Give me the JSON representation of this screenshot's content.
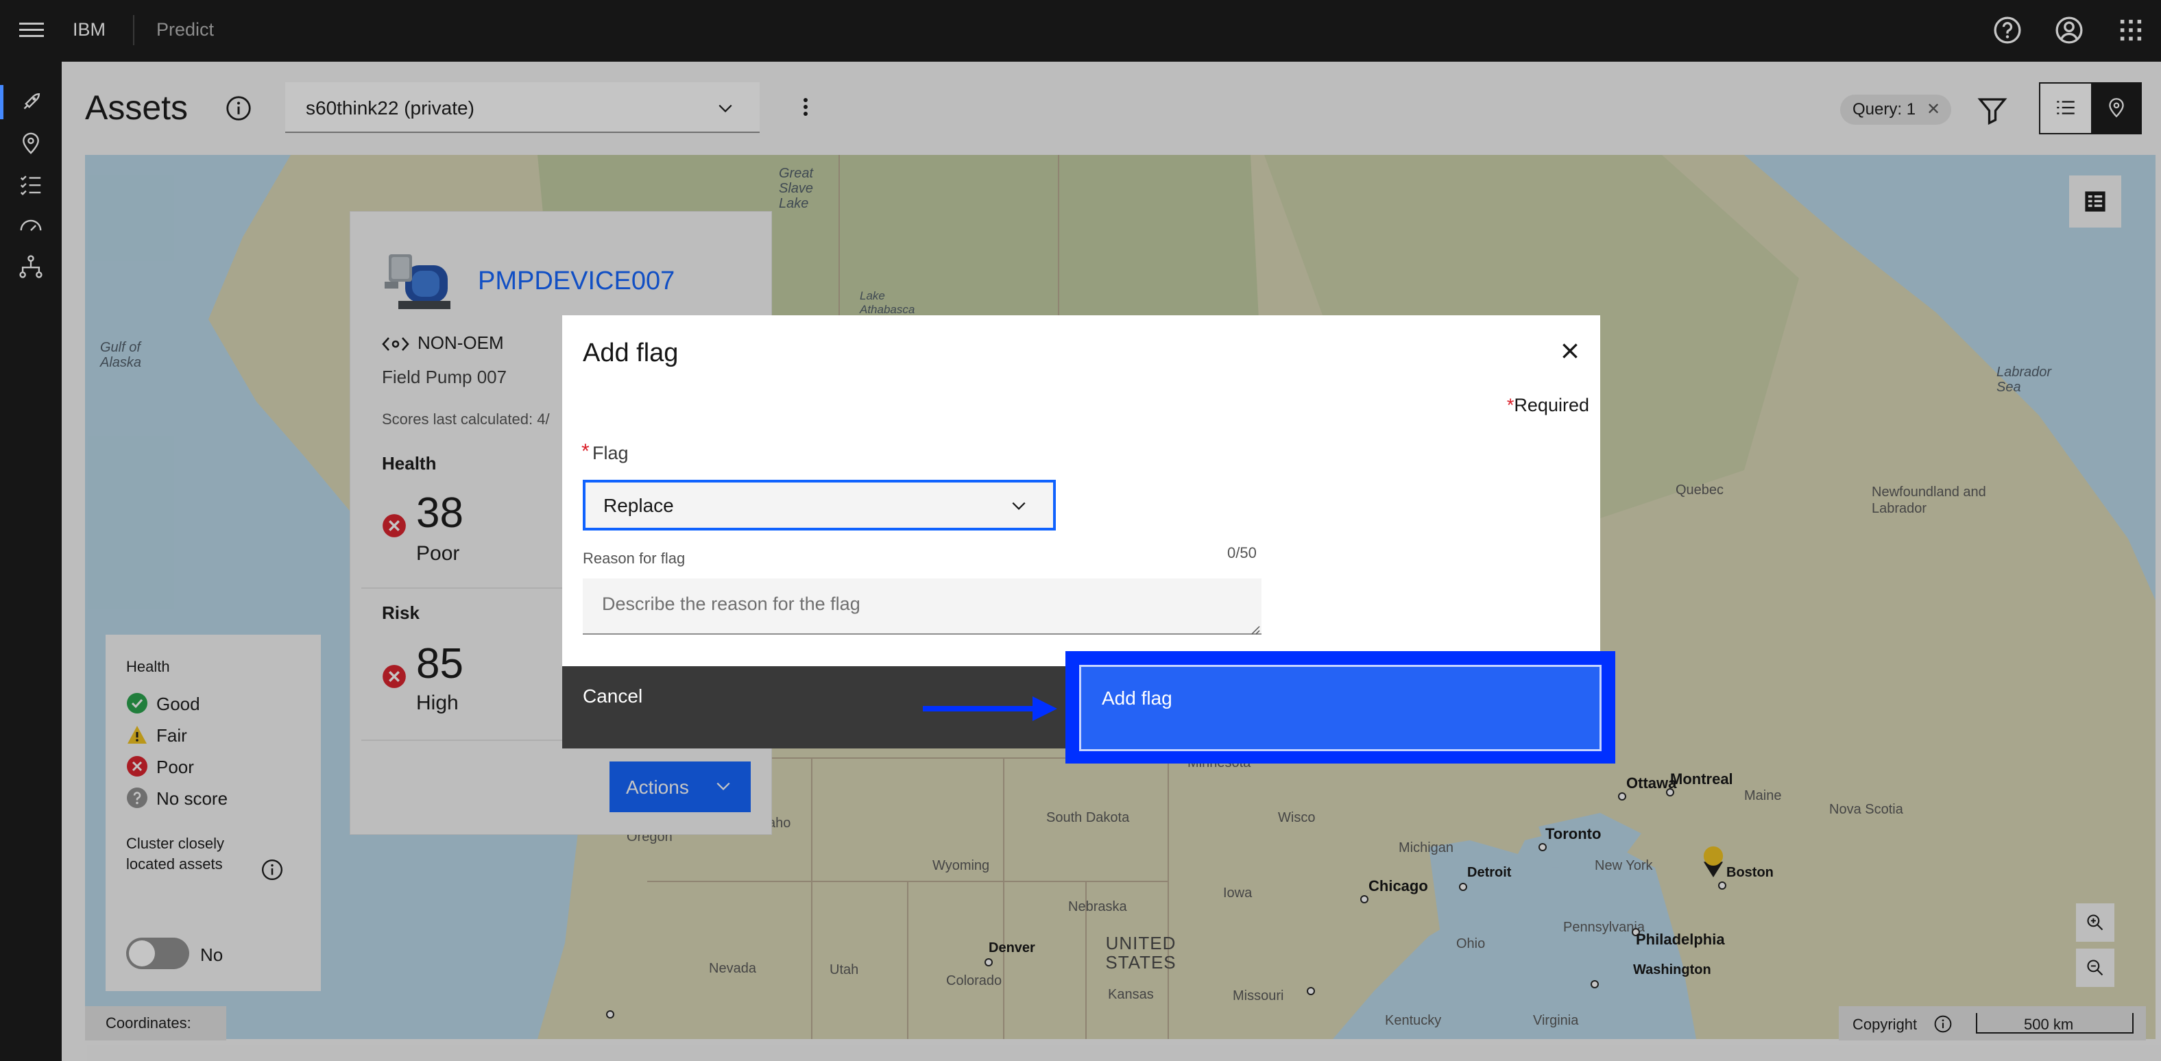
{
  "header": {
    "brand": "IBM",
    "product": "Predict"
  },
  "page": {
    "title": "Assets",
    "dataset_selected": "s60think22 (private)",
    "query_tag": "Query: 1"
  },
  "asset_card": {
    "name": "PMPDEVICE007",
    "oem": "NON-OEM",
    "description": "Field Pump 007",
    "scores_last_calculated": "Scores last calculated: 4/",
    "health": {
      "title": "Health",
      "value": "38",
      "label": "Poor"
    },
    "risk": {
      "title": "Risk",
      "value": "85",
      "label": "High"
    },
    "actions_label": "Actions"
  },
  "legend": {
    "title": "Health",
    "items": [
      {
        "label": "Good",
        "icon": "check-circle-icon",
        "color": "#24a148"
      },
      {
        "label": "Fair",
        "icon": "warning-triangle-icon",
        "color": "#f1c21b"
      },
      {
        "label": "Poor",
        "icon": "error-circle-icon",
        "color": "#da1e28"
      },
      {
        "label": "No score",
        "icon": "help-circle-icon",
        "color": "#8d8d8d"
      }
    ],
    "cluster_label": "Cluster closely located assets",
    "toggle_label": "No"
  },
  "map": {
    "labels": {
      "gulf_of_alaska": "Gulf of Alaska",
      "great_slave_lake": "Great Slave Lake",
      "lake_athabasca": "Lake Athabasca",
      "labrador_sea": "Labrador Sea",
      "quebec": "Quebec",
      "newfoundland": "Newfoundland and Labrador",
      "nova_scotia": "Nova Scotia",
      "maine": "Maine",
      "south_dakota": "South Dakota",
      "wyoming": "Wyoming",
      "nebraska": "Nebraska",
      "iowa": "Iowa",
      "kansas": "Kansas",
      "missouri": "Missouri",
      "colorado": "Colorado",
      "utah": "Utah",
      "nevada": "Nevada",
      "oregon": "Oregon",
      "idaho": "aho",
      "united_states": "UNITED STATES",
      "michigan": "Michigan",
      "ohio": "Ohio",
      "new_york": "New York",
      "pennsylvania": "Pennsylvania",
      "kentucky": "Kentucky",
      "virginia": "Virginia",
      "wisconsin": "Wisco",
      "minnesota": "Minnesota"
    },
    "cities": {
      "ottawa": "Ottawa",
      "montreal": "Montreal",
      "toronto": "Toronto",
      "boston": "Boston",
      "chicago": "Chicago",
      "detroit": "Detroit",
      "denver": "Denver",
      "philadelphia": "Philadelphia",
      "washington": "Washington"
    },
    "coordinates_label": "Coordinates:",
    "copyright_label": "Copyright",
    "scale_label": "500 km"
  },
  "modal": {
    "title": "Add flag",
    "required_note": "Required",
    "required_star": "*",
    "flag_label": "Flag",
    "flag_value": "Replace",
    "reason_label": "Reason for flag",
    "reason_counter": "0/50",
    "reason_placeholder": "Describe the reason for the flag",
    "cancel_label": "Cancel",
    "submit_label": "Add flag"
  },
  "colors": {
    "primary": "#0f62fe",
    "header_bg": "#161616",
    "annotation_frame": "#0030ff"
  }
}
